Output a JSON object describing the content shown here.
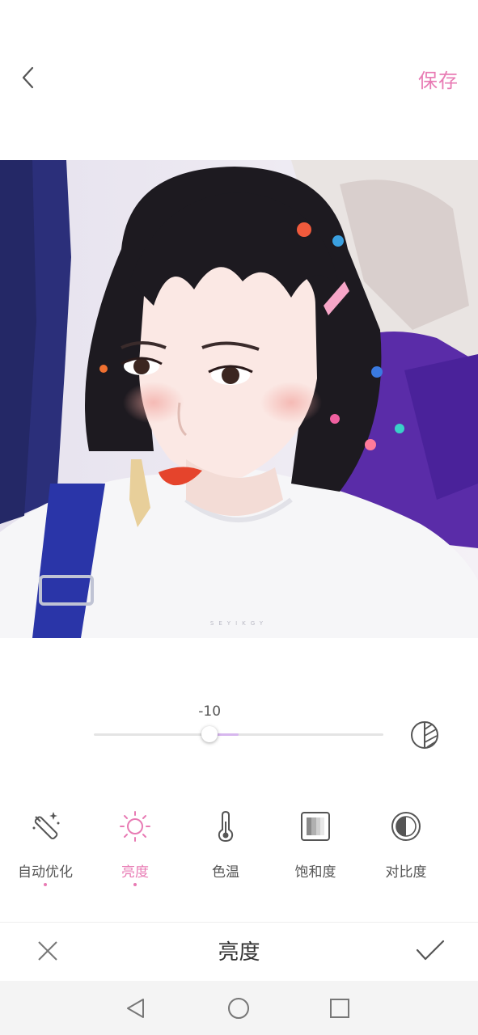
{
  "header": {
    "save_label": "保存",
    "accent_color": "#e87bb4"
  },
  "photo": {
    "watermark": "SEYIKGY"
  },
  "adjust": {
    "value": "-10",
    "value_number": -10,
    "slider_fraction": 0.4
  },
  "tools": [
    {
      "label": "自动优化",
      "icon": "magic-wand-icon",
      "marked": true
    },
    {
      "label": "亮度",
      "icon": "sun-icon",
      "active": true,
      "marked": true
    },
    {
      "label": "色温",
      "icon": "thermometer-icon"
    },
    {
      "label": "饱和度",
      "icon": "saturation-icon"
    },
    {
      "label": "对比度",
      "icon": "contrast-icon"
    }
  ],
  "bottom": {
    "title": "亮度"
  }
}
